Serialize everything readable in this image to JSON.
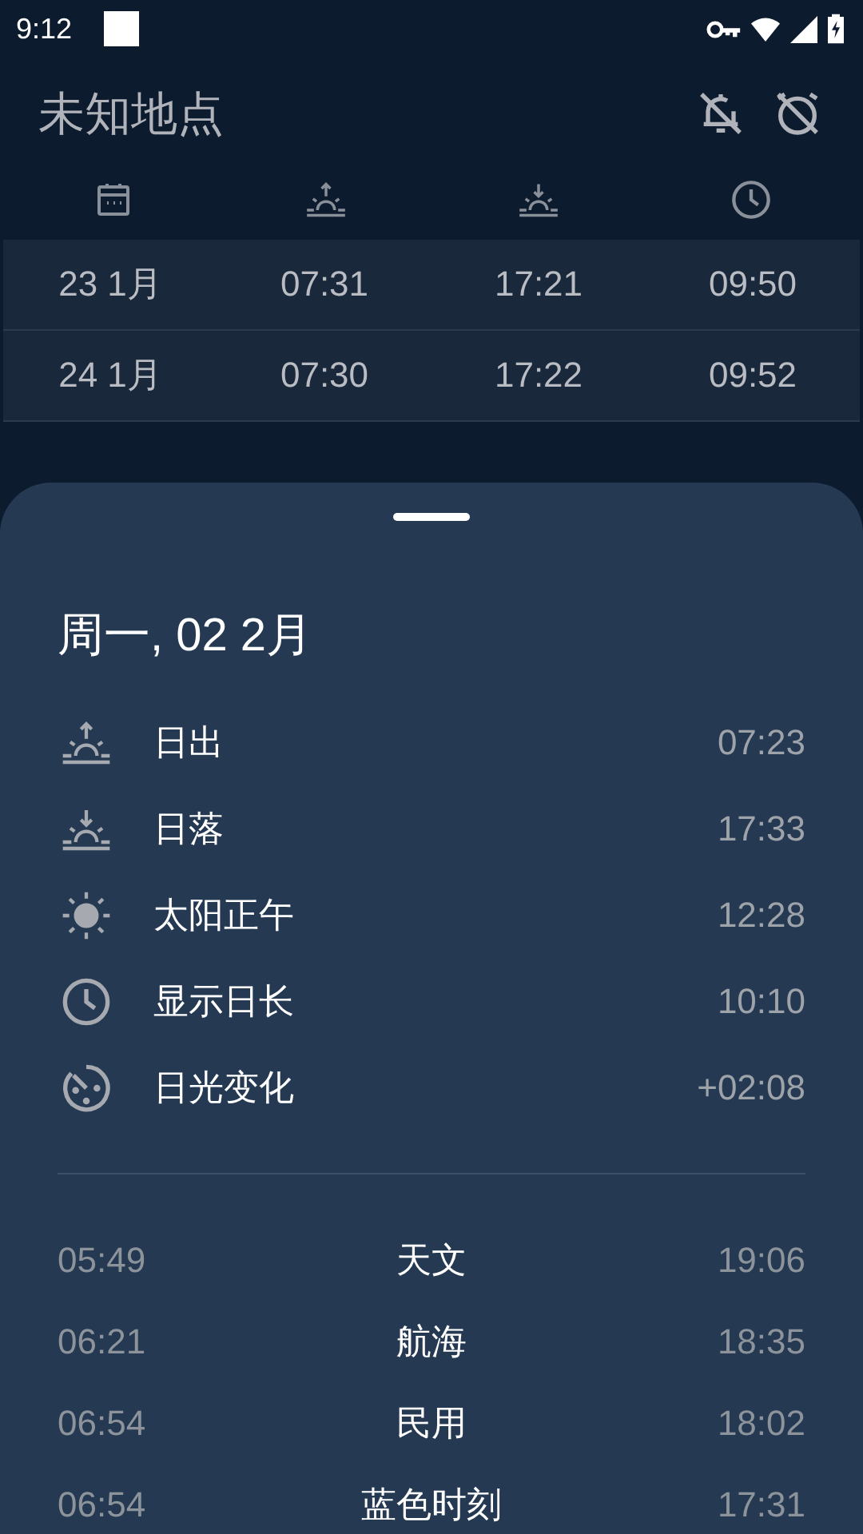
{
  "status_bar": {
    "time": "9:12"
  },
  "header": {
    "title": "未知地点"
  },
  "table": {
    "rows": [
      {
        "date": "23 1月",
        "sunrise": "07:31",
        "sunset": "17:21",
        "length": "09:50"
      },
      {
        "date": "24 1月",
        "sunrise": "07:30",
        "sunset": "17:22",
        "length": "09:52"
      }
    ]
  },
  "sheet": {
    "date": "周一, 02 2月",
    "events": [
      {
        "kind": "sunrise",
        "label": "日出",
        "time": "07:23"
      },
      {
        "kind": "sunset",
        "label": "日落",
        "time": "17:33"
      },
      {
        "kind": "noon",
        "label": "太阳正午",
        "time": "12:28"
      },
      {
        "kind": "length",
        "label": "显示日长",
        "time": "10:10"
      },
      {
        "kind": "change",
        "label": "日光变化",
        "time": "+02:08"
      }
    ],
    "twilight": [
      {
        "start": "05:49",
        "name": "天文",
        "end": "19:06"
      },
      {
        "start": "06:21",
        "name": "航海",
        "end": "18:35"
      },
      {
        "start": "06:54",
        "name": "民用",
        "end": "18:02"
      },
      {
        "start": "06:54",
        "name": "蓝色时刻",
        "end": "17:31"
      }
    ]
  }
}
